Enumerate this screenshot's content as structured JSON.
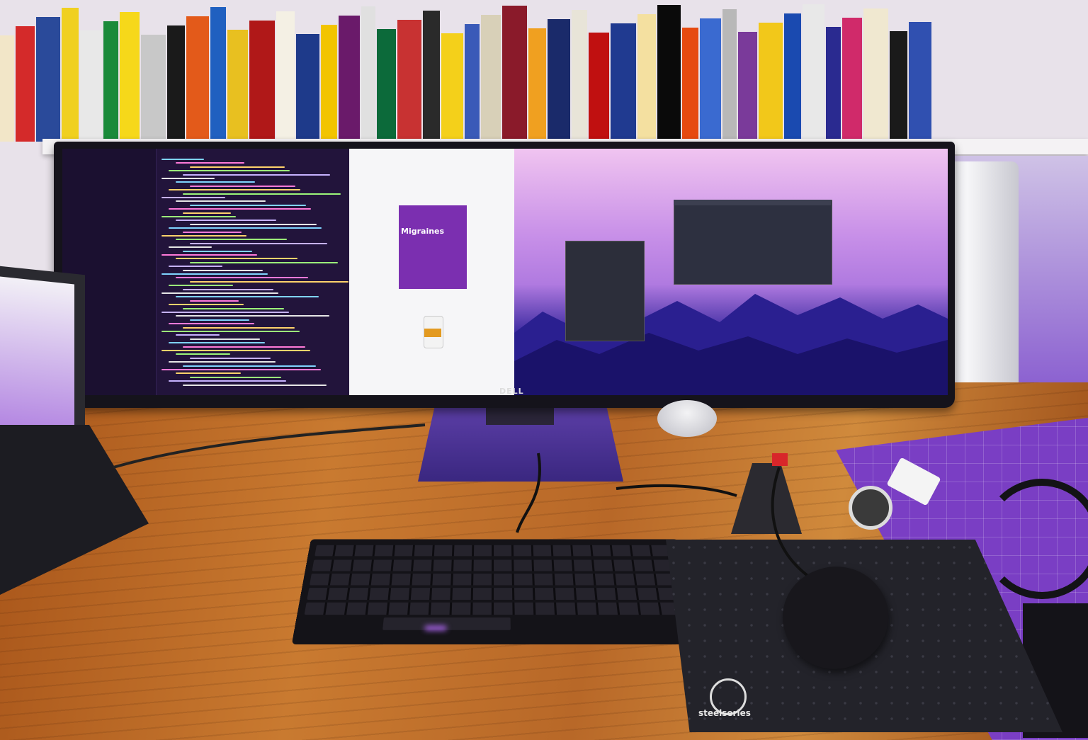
{
  "scene": {
    "description_labels": {
      "monitor_brand": "DELL",
      "mousepad_brand": "steelseries",
      "figma_card_heading": "Migraines"
    }
  },
  "books": {
    "spines": [
      {
        "color": "#f2e6c8"
      },
      {
        "color": "#d42a2a"
      },
      {
        "color": "#2a4a9a"
      },
      {
        "color": "#f0d020"
      },
      {
        "color": "#e8e8e8"
      },
      {
        "color": "#1a8a3a"
      },
      {
        "color": "#f6d81a"
      },
      {
        "color": "#c8c8c8"
      },
      {
        "color": "#1a1a1a"
      },
      {
        "color": "#e35a1a"
      },
      {
        "color": "#2060c0"
      },
      {
        "color": "#e8c020"
      },
      {
        "color": "#b01818"
      },
      {
        "color": "#f4f0e4"
      },
      {
        "color": "#1e3a8a"
      },
      {
        "color": "#f2c400"
      },
      {
        "color": "#6a1a6a"
      },
      {
        "color": "#e0e0e0"
      },
      {
        "color": "#0c6a3a"
      },
      {
        "color": "#c83232"
      },
      {
        "color": "#2a2a2a"
      },
      {
        "color": "#f4d01a"
      },
      {
        "color": "#3a5ab8"
      },
      {
        "color": "#d8d0b8"
      },
      {
        "color": "#8a1a2a"
      },
      {
        "color": "#f0a020"
      },
      {
        "color": "#1a2a6a"
      },
      {
        "color": "#e8e4d8"
      },
      {
        "color": "#c01010"
      },
      {
        "color": "#203a90"
      },
      {
        "color": "#f4e0a0"
      },
      {
        "color": "#0a0a0a"
      },
      {
        "color": "#e64a10"
      },
      {
        "color": "#3a6ad0"
      },
      {
        "color": "#b8b8b8"
      },
      {
        "color": "#7a3a9a"
      },
      {
        "color": "#f2c81a"
      },
      {
        "color": "#1a4ab0"
      },
      {
        "color": "#e8e8e8"
      },
      {
        "color": "#2a2a90"
      },
      {
        "color": "#d02a6a"
      },
      {
        "color": "#f0e8d0"
      },
      {
        "color": "#1a1a1a"
      },
      {
        "color": "#3050b0"
      }
    ]
  },
  "colors": {
    "desk": "#c97a30",
    "mat": "#7a3ec4",
    "screen_desktop_top": "#f0c4f0",
    "screen_desktop_bottom": "#1d1670"
  }
}
